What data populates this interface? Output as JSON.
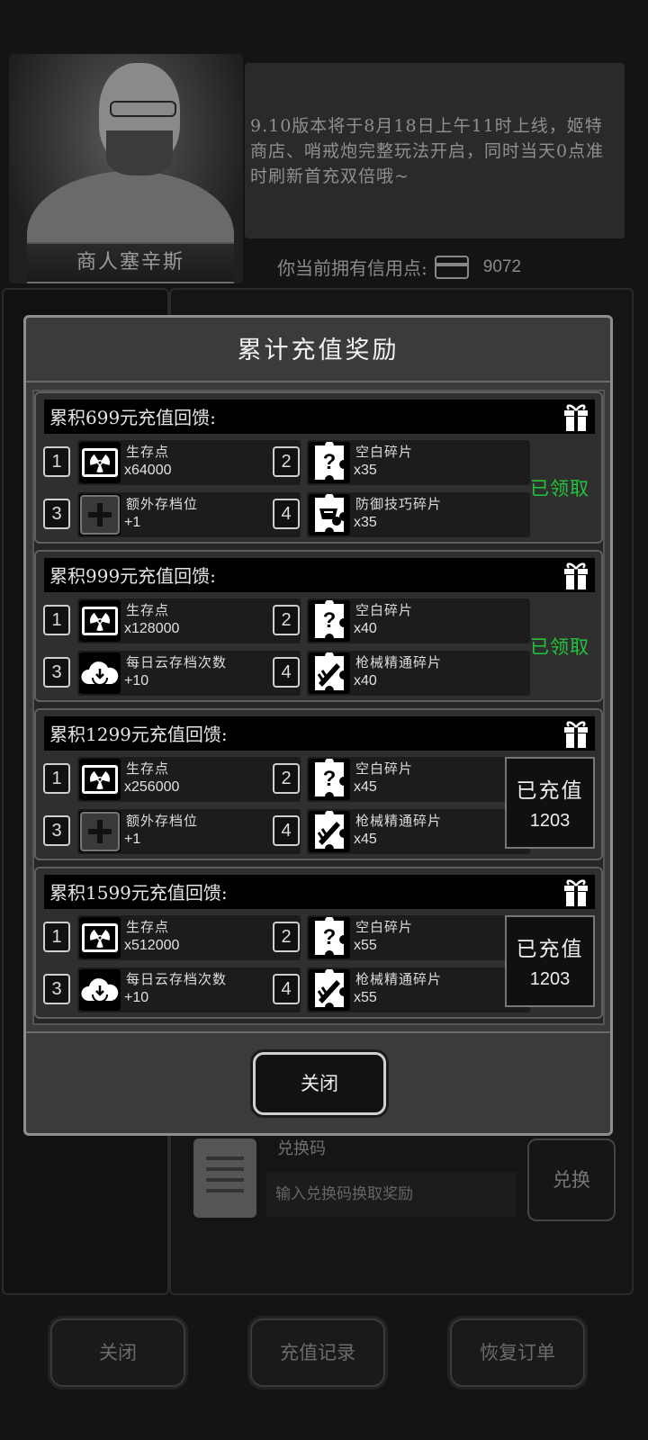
{
  "merchant": {
    "name": "商人塞辛斯"
  },
  "notice": {
    "text": "9.10版本将于8月18日上午11时上线，姬特商店、哨戒炮完整玩法开启，同时当天0点准时刷新首充双倍哦~"
  },
  "credits": {
    "label": "你当前拥有信用点:",
    "value": "9072",
    "icon": "credit-card-icon"
  },
  "redeem": {
    "label": "兑换码",
    "placeholder": "输入兑换码换取奖励",
    "button": "兑换"
  },
  "bottom_bar": {
    "close": "关闭",
    "history": "充值记录",
    "restore": "恢复订单"
  },
  "dialog": {
    "title": "累计充值奖励",
    "close_label": "关闭",
    "tiers": [
      {
        "title": "累积699元充值回馈:",
        "status_type": "claimed",
        "status_text": "已领取",
        "rewards": [
          {
            "index": "1",
            "icon": "radiation-icon",
            "name": "生存点",
            "qty": "x64000"
          },
          {
            "index": "2",
            "icon": "puzzle-blank-icon",
            "name": "空白碎片",
            "qty": "x35"
          },
          {
            "index": "3",
            "icon": "plus-slot-icon",
            "name": "额外存档位",
            "qty": "+1"
          },
          {
            "index": "4",
            "icon": "puzzle-defense-icon",
            "name": "防御技巧碎片",
            "qty": "x35"
          }
        ]
      },
      {
        "title": "累积999元充值回馈:",
        "status_type": "claimed",
        "status_text": "已领取",
        "rewards": [
          {
            "index": "1",
            "icon": "radiation-icon",
            "name": "生存点",
            "qty": "x128000"
          },
          {
            "index": "2",
            "icon": "puzzle-blank-icon",
            "name": "空白碎片",
            "qty": "x40"
          },
          {
            "index": "3",
            "icon": "cloud-save-icon",
            "name": "每日云存档次数",
            "qty": "+10"
          },
          {
            "index": "4",
            "icon": "puzzle-gun-icon",
            "name": "枪械精通碎片",
            "qty": "x40"
          }
        ]
      },
      {
        "title": "累积1299元充值回馈:",
        "status_type": "progress",
        "status_text": "已充值",
        "status_value": "1203",
        "rewards": [
          {
            "index": "1",
            "icon": "radiation-icon",
            "name": "生存点",
            "qty": "x256000"
          },
          {
            "index": "2",
            "icon": "puzzle-blank-icon",
            "name": "空白碎片",
            "qty": "x45"
          },
          {
            "index": "3",
            "icon": "plus-slot-icon",
            "name": "额外存档位",
            "qty": "+1"
          },
          {
            "index": "4",
            "icon": "puzzle-gun-icon",
            "name": "枪械精通碎片",
            "qty": "x45"
          }
        ]
      },
      {
        "title": "累积1599元充值回馈:",
        "status_type": "progress",
        "status_text": "已充值",
        "status_value": "1203",
        "rewards": [
          {
            "index": "1",
            "icon": "radiation-icon",
            "name": "生存点",
            "qty": "x512000"
          },
          {
            "index": "2",
            "icon": "puzzle-blank-icon",
            "name": "空白碎片",
            "qty": "x55"
          },
          {
            "index": "3",
            "icon": "cloud-save-icon",
            "name": "每日云存档次数",
            "qty": "+10"
          },
          {
            "index": "4",
            "icon": "puzzle-gun-icon",
            "name": "枪械精通碎片",
            "qty": "x55"
          }
        ]
      }
    ]
  },
  "colors": {
    "claimed": "#22c43c",
    "panel": "#3b3b3b",
    "border": "#8e8e8e"
  }
}
